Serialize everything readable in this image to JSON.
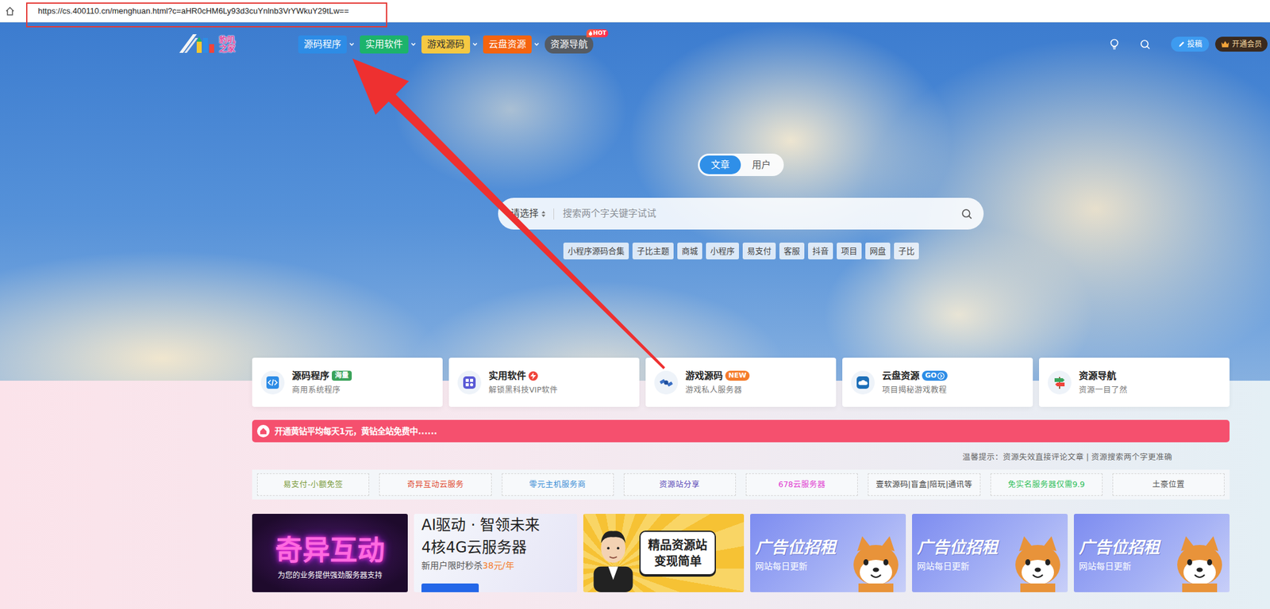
{
  "browser": {
    "url": "https://cs.400110.cn/menghuan.html?c=aHR0cHM6Ly93d3cuYnlnb3VrYWkuY29tLw=="
  },
  "nav": {
    "logo": "豹叽之家",
    "items": [
      {
        "label": "源码程序",
        "color": "#2d8ce6",
        "dropdown": true
      },
      {
        "label": "实用软件",
        "color": "#1cb36b",
        "dropdown": true
      },
      {
        "label": "游戏源码",
        "color": "#f5c842",
        "dropdown": true
      },
      {
        "label": "云盘资源",
        "color": "#f5640f",
        "dropdown": true
      },
      {
        "label": "资源导航",
        "color": "#555b63",
        "dropdown": false,
        "badge": "HOT"
      }
    ],
    "contribute": "投稿",
    "vip": "开通会员"
  },
  "search": {
    "tabs": [
      {
        "label": "文章",
        "selected": true
      },
      {
        "label": "用户",
        "selected": false
      }
    ],
    "select": "请选择",
    "placeholder": "搜索两个字关键字试试",
    "tags": [
      "小程序源码合集",
      "子比主题",
      "商城",
      "小程序",
      "易支付",
      "客服",
      "抖音",
      "项目",
      "网盘",
      "子比"
    ]
  },
  "categories": [
    {
      "title": "源码程序",
      "subtitle": "商用系统程序",
      "kind": "pill",
      "badge": "海量",
      "color": "#3aa35a"
    },
    {
      "title": "实用软件",
      "subtitle": "解锁黑科技VIP软件",
      "kind": "bolt",
      "color": "#f0443a"
    },
    {
      "title": "游戏源码",
      "subtitle": "游戏私人服务器",
      "kind": "new",
      "badge": "NEW",
      "color": "#f57c2b"
    },
    {
      "title": "云盘资源",
      "subtitle": "项目揭秘游戏教程",
      "kind": "go",
      "badge": "GO",
      "color": "#2d8ce6"
    },
    {
      "title": "资源导航",
      "subtitle": "资源一目了然",
      "kind": "none"
    }
  ],
  "notice": "开通黄钻平均每天1元，黄钻全站免费中......",
  "tip": "温馨提示：资源失效直接评论文章 | 资源搜索两个字更准确",
  "links": [
    {
      "label": "易支付-小额免签",
      "color": "#7a9a3a"
    },
    {
      "label": "奇异互动云服务",
      "color": "#e0482e"
    },
    {
      "label": "零元主机服务商",
      "color": "#3d8fd6"
    },
    {
      "label": "资源站分享",
      "color": "#5b4ab8"
    },
    {
      "label": "678云服务器",
      "color": "#e03ad0"
    },
    {
      "label": "壹软源码|盲盒|陪玩|通讯等",
      "color": "#444444"
    },
    {
      "label": "免实名服务器仅需9.9",
      "color": "#2fbf5a"
    },
    {
      "label": "土豪位置",
      "color": "#555555"
    }
  ],
  "banners": [
    {
      "kind": "neon",
      "title": "奇异互动",
      "line": "为您的业务提供强劲服务器支持"
    },
    {
      "kind": "promo",
      "title": "AI驱动 · 智领未来",
      "line": "4核4G云服务器",
      "promo": "新用户限时秒杀",
      "price": "38元/年"
    },
    {
      "kind": "bubble",
      "title": "精品资源站",
      "line": "变现简单"
    },
    {
      "kind": "ad",
      "title": "广告位招租",
      "line": "网站每日更新"
    },
    {
      "kind": "ad",
      "title": "广告位招租",
      "line": "网站每日更新"
    },
    {
      "kind": "ad",
      "title": "广告位招租",
      "line": "网站每日更新"
    }
  ]
}
